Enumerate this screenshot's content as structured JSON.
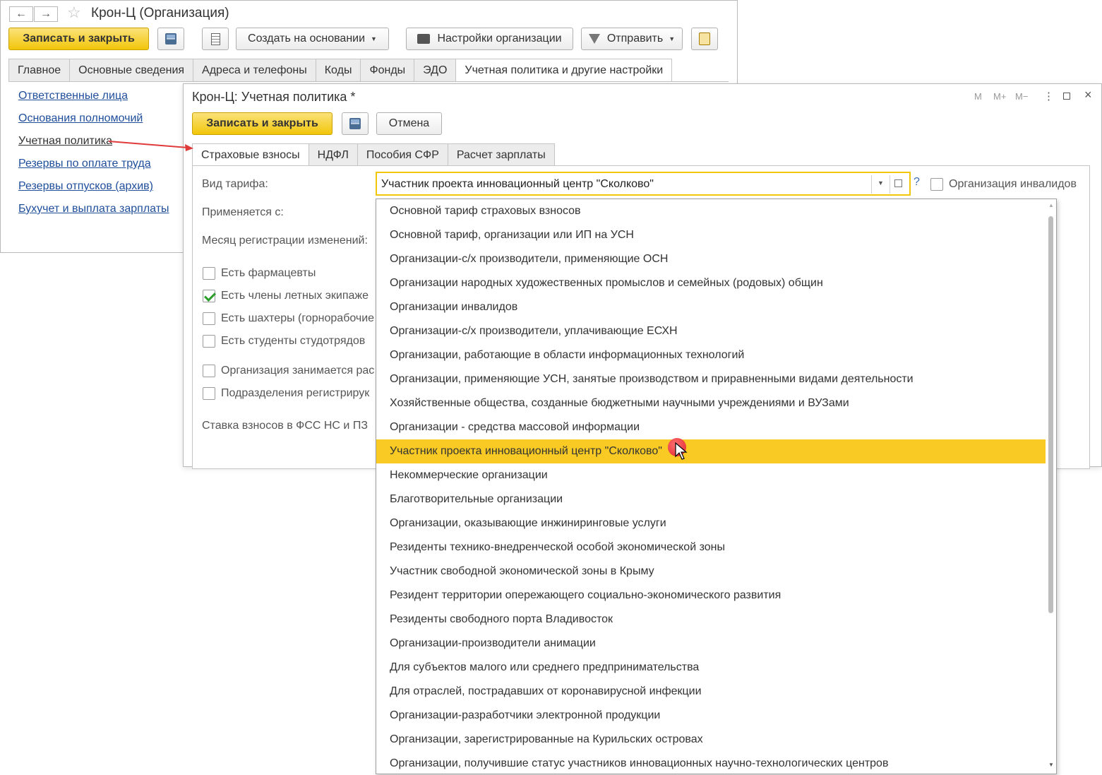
{
  "org_window": {
    "title": "Крон-Ц (Организация)",
    "toolbar": {
      "save_close": "Записать и закрыть",
      "create_basis": "Создать на основании",
      "org_settings": "Настройки организации",
      "send": "Отправить"
    },
    "tabs": [
      "Главное",
      "Основные сведения",
      "Адреса и телефоны",
      "Коды",
      "Фонды",
      "ЭДО",
      "Учетная политика и другие настройки"
    ],
    "links": [
      "Ответственные лица",
      "Основания полномочий",
      "Учетная политика",
      "Резервы по оплате труда",
      "Резервы отпусков (архив)",
      "Бухучет и выплата зарплаты"
    ]
  },
  "policy_window": {
    "title": "Крон-Ц: Учетная политика *",
    "controls": [
      "M",
      "M+",
      "M−"
    ],
    "toolbar": {
      "save_close": "Записать и закрыть",
      "cancel": "Отмена"
    },
    "tabs": [
      "Страховые взносы",
      "НДФЛ",
      "Пособия СФР",
      "Расчет зарплаты"
    ],
    "labels": {
      "tariff": "Вид тарифа:",
      "applied_from": "Применяется с:",
      "month_reg": "Месяц регистрации изменений:",
      "rate_fss": "Ставка взносов в ФСС НС и ПЗ"
    },
    "tariff_value": "Участник проекта инновационный центр \"Сколково\"",
    "help": "?",
    "invalids_checkbox": "Организация инвалидов",
    "checkboxes": [
      {
        "label": "Есть фармацевты",
        "checked": false
      },
      {
        "label": "Есть члены летных экипаже",
        "checked": true
      },
      {
        "label": "Есть шахтеры (горнорабочие",
        "checked": false
      },
      {
        "label": "Есть студенты студотрядов",
        "checked": false
      },
      {
        "label": "Организация занимается рас",
        "checked": false
      },
      {
        "label": "Подразделения регистрирук",
        "checked": false
      }
    ]
  },
  "dropdown": {
    "selected_index": 10,
    "items": [
      "Основной тариф страховых взносов",
      "Основной тариф, организации или ИП на УСН",
      "Организации-с/х производители, применяющие ОСН",
      "Организации народных художественных промыслов и семейных (родовых) общин",
      "Организации инвалидов",
      "Организации-с/х производители, уплачивающие ЕСХН",
      "Организации, работающие в области информационных технологий",
      "Организации, применяющие УСН, занятые производством и приравненными видами деятельности",
      "Хозяйственные общества, созданные бюджетными научными учреждениями и ВУЗами",
      "Организации - средства массовой информации",
      "Участник проекта инновационный центр \"Сколково\"",
      "Некоммерческие организации",
      "Благотворительные организации",
      "Организации, оказывающие инжиниринговые услуги",
      "Резиденты технико-внедренческой особой экономической зоны",
      "Участник свободной экономической зоны в Крыму",
      "Резидент территории опережающего социально-экономического развития",
      "Резиденты свободного порта Владивосток",
      "Организации-производители анимации",
      "Для субъектов малого или среднего предпринимательства",
      "Для отраслей, пострадавших от коронавирусной инфекции",
      "Организации-разработчики электронной продукции",
      "Организации, зарегистрированные на Курильских островах",
      "Организации, получившие статус участников инновационных научно-технологических центров"
    ]
  },
  "colors": {
    "accent_yellow": "#f2c60b",
    "highlight": "#f8ca23",
    "link": "#1f4e9b",
    "arrow": "#e03b3b"
  }
}
